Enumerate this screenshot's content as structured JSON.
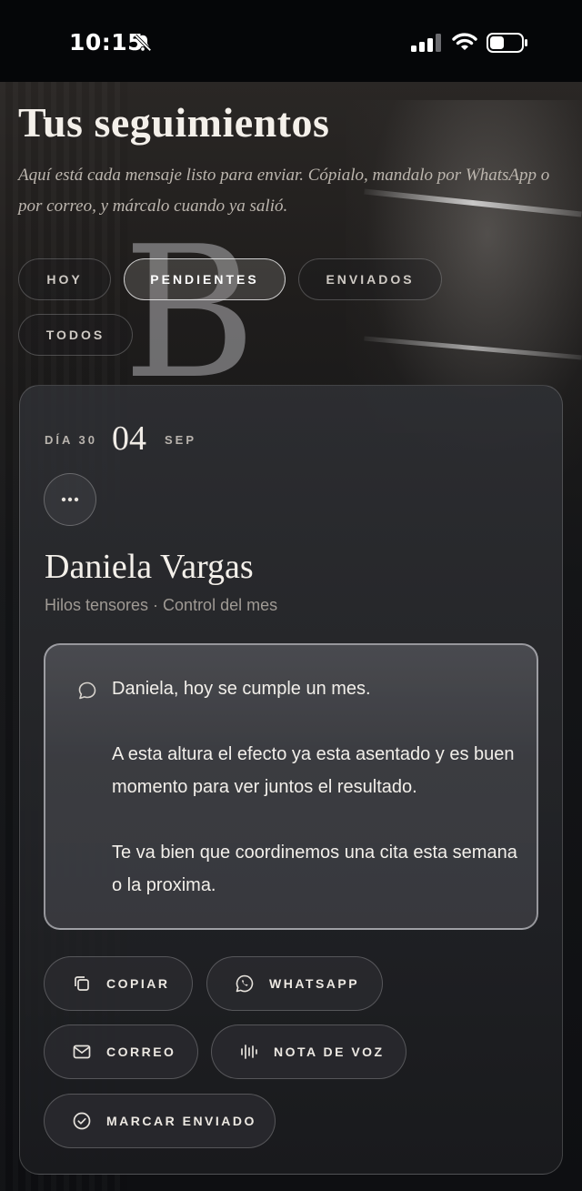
{
  "status_bar": {
    "time": "10:15",
    "icons": [
      "bell-muted-icon",
      "signal-icon",
      "wifi-icon",
      "battery-icon"
    ]
  },
  "background": {
    "monogram": "B"
  },
  "header": {
    "title": "Tus seguimientos",
    "subtitle": "Aquí está cada mensaje listo para enviar. Cópialo, mandalo por WhatsApp o por correo, y márcalo cuando ya salió."
  },
  "filters": [
    {
      "label": "HOY",
      "active": false
    },
    {
      "label": "PENDIENTES",
      "active": true
    },
    {
      "label": "ENVIADOS",
      "active": false
    },
    {
      "label": "TODOS",
      "active": false
    }
  ],
  "card": {
    "day_label": "DÍA 30",
    "date_day": "04",
    "date_month": "SEP",
    "more_icon": "more-horizontal-icon",
    "client_name": "Daniela Vargas",
    "meta": "Hilos tensores · Control del mes",
    "message": "Daniela, hoy se cumple un mes.\n\nA esta altura el efecto ya esta asentado y es buen momento para ver juntos el resultado.\n\nTe va bien que coordinemos una cita esta semana o la proxima.",
    "actions": {
      "copy": "COPIAR",
      "whatsapp": "WHATSAPP",
      "email": "CORREO",
      "voice": "NOTA DE VOZ",
      "mark_sent": "MARCAR ENVIADO"
    }
  },
  "colors": {
    "background": "#0b0c0e",
    "card": "#2a2b2f",
    "text": "#f4f0ea",
    "muted": "#9f9a94",
    "accent_border": "#e6e6eb"
  }
}
